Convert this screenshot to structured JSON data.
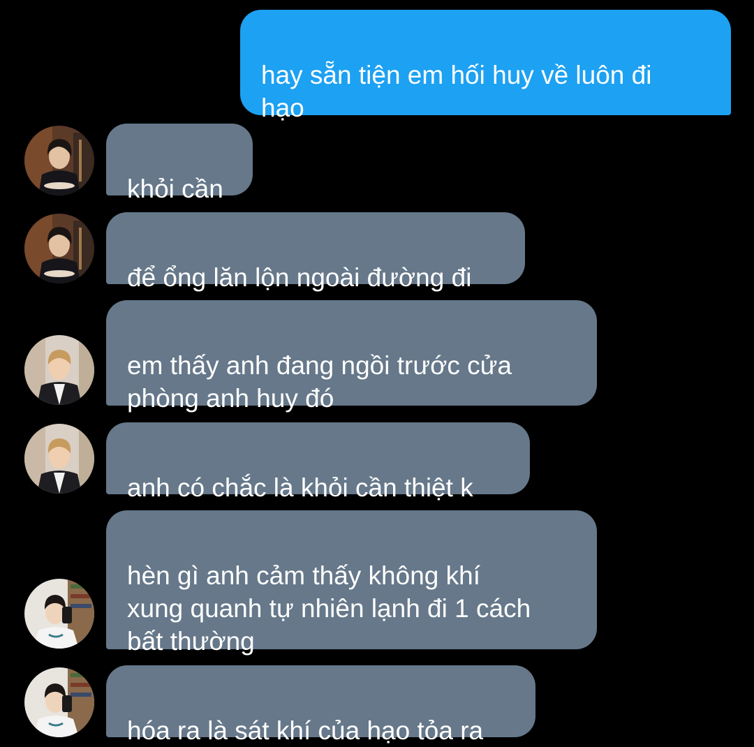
{
  "messages": [
    {
      "sender": "me",
      "text": "hay sẵn tiện em hối huy về luôn đi\nhạo"
    },
    {
      "sender": "contact-a",
      "text": "khỏi cần"
    },
    {
      "sender": "contact-a",
      "text": "để ổng lăn lộn ngoài đường đi"
    },
    {
      "sender": "contact-b",
      "text": "em thấy anh đang ngồi trước cửa\nphòng anh huy đó"
    },
    {
      "sender": "contact-b",
      "text": "anh có chắc là khỏi cần thiệt k"
    },
    {
      "sender": "contact-c",
      "text": "hèn gì anh cảm thấy không khí\nxung quanh tự nhiên lạnh đi 1 cách\nbất thường"
    },
    {
      "sender": "contact-c",
      "text": "hóa ra là sát khí của hạo tỏa ra"
    }
  ],
  "colors": {
    "background": "#000000",
    "outgoing_bubble": "#1da1f2",
    "incoming_bubble": "#66788a",
    "text": "#ffffff"
  },
  "avatars": {
    "contact-a": "dark-haired-man-dining-photo",
    "contact-b": "light-haired-man-smiling-photo",
    "contact-c": "mirror-selfie-photo"
  }
}
